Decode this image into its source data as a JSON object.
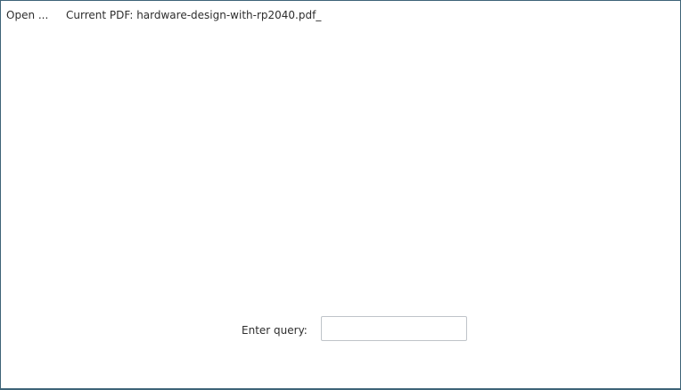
{
  "toolbar": {
    "open_label": "Open ...",
    "current_pdf": "Current PDF: hardware-design-with-rp2040.pdf_"
  },
  "query": {
    "label": "Enter query:",
    "value": "",
    "placeholder": ""
  },
  "colors": {
    "window_border": "#3e6478",
    "input_border": "#bfc4c9",
    "text": "#2e2e2e",
    "background": "#ffffff"
  }
}
